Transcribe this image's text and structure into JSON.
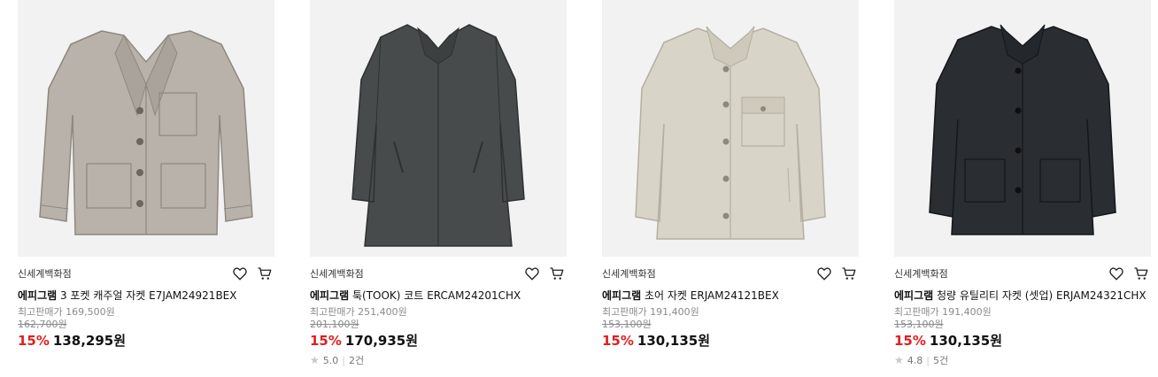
{
  "products": [
    {
      "store": "신세계백화점",
      "brand": "에피그램",
      "name": " 3 포켓 캐주얼 자켓 E7JAM24921BEX",
      "max_price": "최고판매가 169,500원",
      "orig_price": "162,700원",
      "discount": "15%",
      "price": "138,295원",
      "rating": "",
      "review_count": "",
      "jacket_color": "#b8b2aa",
      "style": "jacket-pockets"
    },
    {
      "store": "신세계백화점",
      "brand": "에피그램",
      "name": " 툭(TOOK) 코트 ERCAM24201CHX",
      "max_price": "최고판매가 251,400원",
      "orig_price": "201,100원",
      "discount": "15%",
      "price": "170,935원",
      "rating": "5.0",
      "review_count": "2건",
      "jacket_color": "#474b4c",
      "style": "coat"
    },
    {
      "store": "신세계백화점",
      "brand": "에피그램",
      "name": " 초어 자켓 ERJAM24121BEX",
      "max_price": "최고판매가 191,400원",
      "orig_price": "153,100원",
      "discount": "15%",
      "price": "130,135원",
      "rating": "",
      "review_count": "",
      "jacket_color": "#d9d4c8",
      "style": "chore"
    },
    {
      "store": "신세계백화점",
      "brand": "에피그램",
      "name": " 청량 유틸리티 자켓 (셋업) ERJAM24321CHX",
      "max_price": "최고판매가 191,400원",
      "orig_price": "153,100원",
      "discount": "15%",
      "price": "130,135원",
      "rating": "4.8",
      "review_count": "5건",
      "jacket_color": "#2a2d31",
      "style": "jacket-dark"
    }
  ],
  "icons": {
    "wishlist": "heart-icon",
    "cart": "cart-icon",
    "star": "star-icon"
  }
}
